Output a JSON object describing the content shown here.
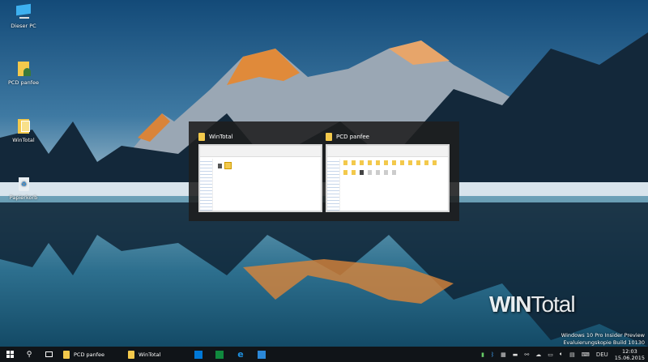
{
  "desktop": {
    "icons": [
      {
        "label": "Dieser PC",
        "icon": "computer-icon"
      },
      {
        "label": "PCD panfee",
        "icon": "user-folder-icon"
      },
      {
        "label": "WinTotal",
        "icon": "folder-icon"
      },
      {
        "label": "Papierkorb",
        "icon": "recycle-bin-icon"
      }
    ]
  },
  "alttab": {
    "windows": [
      {
        "title": "WinTotal"
      },
      {
        "title": "PCD panfee"
      }
    ]
  },
  "watermark": {
    "logo": "WIN Total",
    "line1": "Windows 10 Pro Insider Preview",
    "line2": "Evaluierungskopie Build 10130"
  },
  "taskbar": {
    "apps": [
      {
        "label": "PCD panfee"
      },
      {
        "label": "WinTotal"
      }
    ],
    "pinned": [
      "store-icon",
      "store-green-icon",
      "edge-icon",
      "settings-icon"
    ],
    "lang": "DEU",
    "time": "12:03",
    "date": "15.06.2015"
  },
  "colors": {
    "taskbar": "#101418",
    "accent": "#0078d7"
  }
}
